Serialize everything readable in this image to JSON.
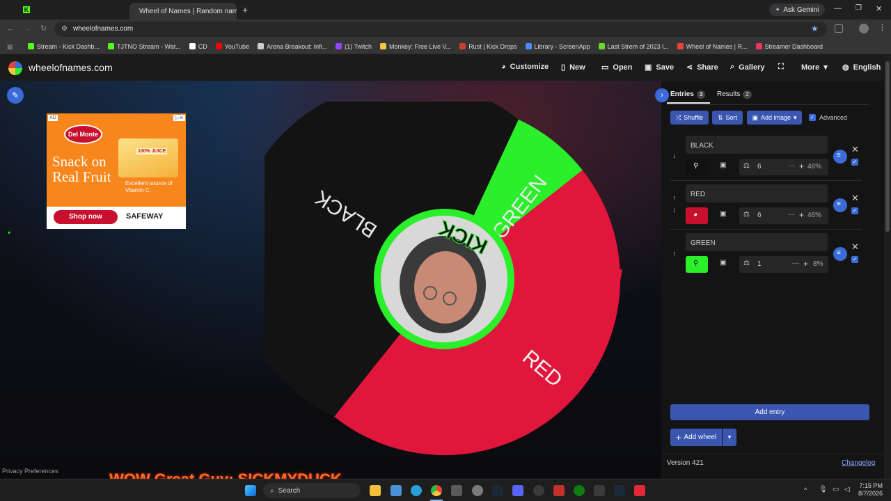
{
  "browser": {
    "active_tab": "Wheel of Names | Random nam",
    "url": "wheelofnames.com",
    "ask_gemini": "Ask Gemini",
    "bookmarks": [
      {
        "label": "Stream - Kick Dashb...",
        "color": "#53fc18"
      },
      {
        "label": "TJTNO Stream - Wat...",
        "color": "#53fc18"
      },
      {
        "label": "CD",
        "color": "#ffffff"
      },
      {
        "label": "YouTube",
        "color": "#ff0000"
      },
      {
        "label": "Arena Breakout: Infi...",
        "color": "#cccccc"
      },
      {
        "label": "(1) Twitch",
        "color": "#9146ff"
      },
      {
        "label": "Monkey: Free Live V...",
        "color": "#f5c542"
      },
      {
        "label": "Rust | Kick Drops",
        "color": "#cd412b"
      },
      {
        "label": "Library - ScreenApp",
        "color": "#4a8cff"
      },
      {
        "label": "Last Strem of 2023 l...",
        "color": "#6bd82a"
      },
      {
        "label": "Wheel of Names | R...",
        "color": "#e8443a"
      },
      {
        "label": "Streamer Dashboard",
        "color": "#e83a5a"
      }
    ]
  },
  "site": {
    "logo_text": "wheelofnames.com",
    "nav": [
      {
        "id": "customize",
        "label": "Customize",
        "icon": "palette-icon"
      },
      {
        "id": "new",
        "label": "New",
        "icon": "file-icon"
      },
      {
        "id": "open",
        "label": "Open",
        "icon": "folder-icon"
      },
      {
        "id": "save",
        "label": "Save",
        "icon": "save-icon"
      },
      {
        "id": "share",
        "label": "Share",
        "icon": "share-icon"
      },
      {
        "id": "gallery",
        "label": "Gallery",
        "icon": "search-icon"
      },
      {
        "id": "fullscreen",
        "label": "",
        "icon": "fullscreen-icon"
      },
      {
        "id": "more",
        "label": "More",
        "icon": "chevron-down-icon"
      },
      {
        "id": "language",
        "label": "English",
        "icon": "globe-icon"
      }
    ]
  },
  "ad": {
    "badge": "AD",
    "brand": "Del Monte",
    "headline": "Snack on Real Fruit",
    "product": "100% JUICE",
    "tagline": "Excellent source of Vitamin C.",
    "cta": "Shop now",
    "retailer": "SAFEWAY"
  },
  "wheel": {
    "segments": [
      {
        "label": "BLACK",
        "color": "#151515"
      },
      {
        "label": "RED",
        "color": "#e0163c"
      },
      {
        "label": "GREEN",
        "color": "#2bef2b"
      }
    ],
    "center_text": "KICK"
  },
  "panel": {
    "tabs": [
      {
        "label": "Entries",
        "count": "3"
      },
      {
        "label": "Results",
        "count": "2"
      }
    ],
    "toolbar": {
      "shuffle": "Shuffle",
      "sort": "Sort",
      "add_image": "Add image",
      "advanced": "Advanced"
    },
    "entries": [
      {
        "name": "BLACK",
        "weight": "6",
        "percent": "46%",
        "color": "#111111"
      },
      {
        "name": "RED",
        "weight": "6",
        "percent": "46%",
        "color": "#c7102e"
      },
      {
        "name": "GREEN",
        "weight": "1",
        "percent": "8%",
        "color": "#2bef2b"
      }
    ],
    "add_entry": "Add entry",
    "add_wheel": "Add wheel",
    "version": "Version 421",
    "changelog": "Changelog"
  },
  "footer": {
    "privacy": "Privacy Preferences",
    "overlay_text": "WOW Great Guy: SICKMYDUCK"
  },
  "taskbar": {
    "search": "Search",
    "time": "7:15 PM",
    "date": "8/7/2026"
  }
}
